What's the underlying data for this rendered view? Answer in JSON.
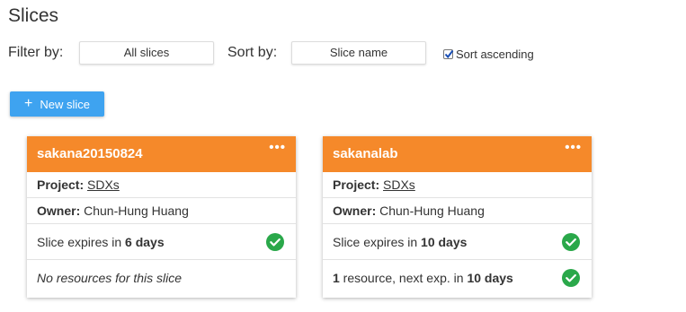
{
  "page": {
    "title": "Slices"
  },
  "filters": {
    "filter_label": "Filter by:",
    "filter_value": "All slices",
    "sort_label": "Sort by:",
    "sort_value": "Slice name",
    "sort_ascending_label": "Sort ascending",
    "sort_ascending_checked": true
  },
  "actions": {
    "new_slice_label": "New slice"
  },
  "colors": {
    "accent": "#f5892a",
    "primary_button": "#3ea3f0",
    "ok": "#2aa84a"
  },
  "cards": [
    {
      "name": "sakana20150824",
      "menu": "•••",
      "project_label": "Project:",
      "project_value": "SDXs",
      "owner_label": "Owner:",
      "owner_value": "Chun-Hung Huang",
      "expiry_prefix": "Slice expires in ",
      "expiry_value": "6 days",
      "resources_text": "No resources for this slice",
      "resources_count": "",
      "resources_mid": "",
      "resources_exp": ""
    },
    {
      "name": "sakanalab",
      "menu": "•••",
      "project_label": "Project:",
      "project_value": "SDXs",
      "owner_label": "Owner:",
      "owner_value": "Chun-Hung Huang",
      "expiry_prefix": "Slice expires in ",
      "expiry_value": "10 days",
      "resources_count": "1",
      "resources_mid": " resource, next exp. in ",
      "resources_exp": "10 days"
    }
  ]
}
